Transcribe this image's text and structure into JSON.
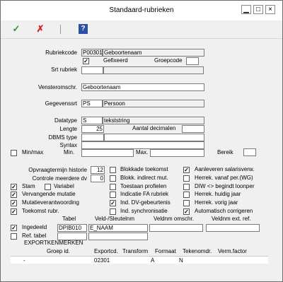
{
  "window": {
    "title": "Standaard-rubrieken"
  },
  "titlebar_buttons": {
    "minimize": "▁",
    "maximize": "□",
    "close": "×"
  },
  "toolbar": {
    "ok": "✓",
    "cancel": "✗",
    "help": "?"
  },
  "form": {
    "rubriekcode_label": "Rubriekcode",
    "rubriekcode": "P00301",
    "rubriekcode_name": "Geboortenaam",
    "gefixeerd_label": "Gefixeerd",
    "gefixeerd": true,
    "groepcode_label": "Groepcode",
    "groepcode": "",
    "srt_rubriek_label": "Srt rubriek",
    "vensteromschr_label": "Vensteromschr.",
    "vensteromschr": "Geboortenaam",
    "gegevenssrt_label": "Gegevenssrt",
    "gegevenssrt_code": "PS",
    "gegevenssrt_name": "Persoon",
    "datatype_label": "Datatype",
    "datatype_code": "S",
    "datatype_name": "tekststring",
    "lengte_label": "Lengte",
    "lengte": "25",
    "aantal_decimalen_label": "Aantal decimalen",
    "dbms_type_label": "DBMS type",
    "syntax_label": "Syntax",
    "minmax_label": "Min/max",
    "min_label": "Min.",
    "max_label": "Max.",
    "bereik_label": "Bereik",
    "opvraagtermijn_label": "Opvraagtermijn historie",
    "opvraagtermijn": "12",
    "controle_label": "Controle meerdere dv",
    "controle": "0"
  },
  "checkboxes_col1": [
    {
      "label": "Stam",
      "checked": true
    },
    {
      "label": "Vervangende mutatie",
      "checked": true
    },
    {
      "label": "Mutatieverantwoording",
      "checked": true
    },
    {
      "label": "Toekomst rubr.",
      "checked": true
    }
  ],
  "variabel": {
    "label": "Variabel",
    "checked": false
  },
  "checkboxes_col2": [
    {
      "label": "Blokkade toekomst",
      "checked": false
    },
    {
      "label": "Blokk. indirect mut.",
      "checked": false
    },
    {
      "label": "Toestaan profielen",
      "checked": false
    },
    {
      "label": "Indicatie FA rubriek",
      "checked": false
    },
    {
      "label": "Ind. DV-gebeurtenis",
      "checked": true
    },
    {
      "label": "Ind. synchronisatie",
      "checked": false
    }
  ],
  "checkboxes_col3": [
    {
      "label": "Aanleveren salarisverw.",
      "checked": true
    },
    {
      "label": "Herrek. vanaf per.(WG)",
      "checked": false
    },
    {
      "label": "DIW <> begindt loonper",
      "checked": false
    },
    {
      "label": "Herrek. huidig jaar",
      "checked": false
    },
    {
      "label": "Herrek. vorig jaar",
      "checked": false
    },
    {
      "label": "Automatisch corrigeren",
      "checked": true
    }
  ],
  "tabel": {
    "tabel_header": "Tabel",
    "veld_header": "Veld-/Sleutelnm",
    "veldnm_omschr_header": "Veldnm omschr.",
    "veldnm_ext_header": "Veldnm ext. ref.",
    "ingedeeld_label": "Ingedeeld",
    "ingedeeld": true,
    "tabel_value": "DPIB010",
    "veld_value": "E_NAAM",
    "ref_tabel_label": "Ref. tabel",
    "ref_tabel": false
  },
  "export": {
    "title": "EXPORTKENMERKEN",
    "columns": [
      "Groep id.",
      "Exportcd.",
      "Transform",
      "Formaat",
      "Tekenomdr.",
      "Verm.factor"
    ],
    "rows": [
      [
        "-",
        "02301",
        "",
        "A",
        "N",
        ""
      ]
    ]
  }
}
